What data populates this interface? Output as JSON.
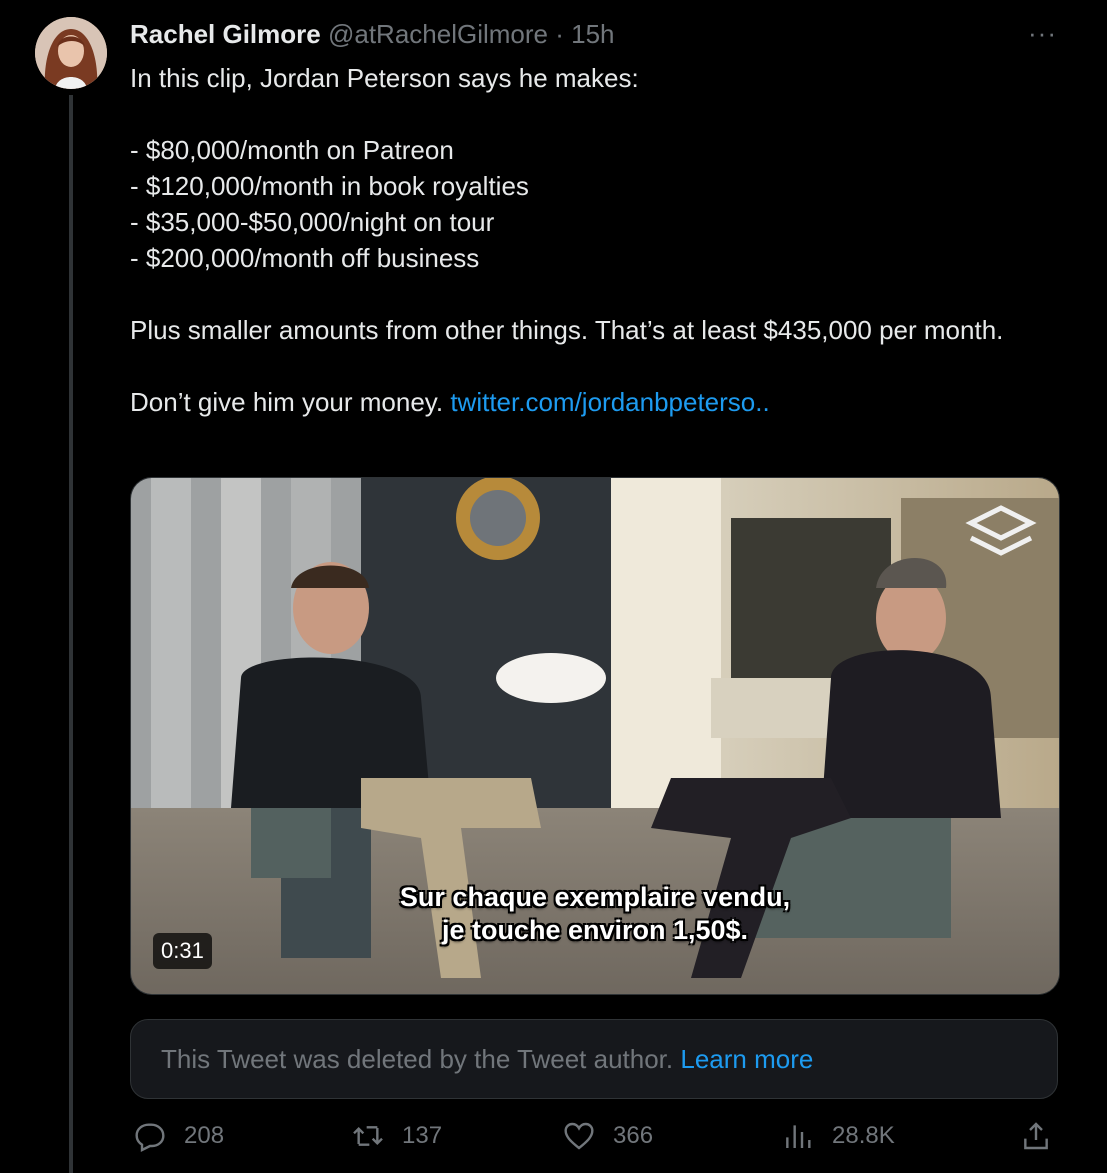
{
  "tweet": {
    "author_name": "Rachel Gilmore",
    "author_handle": "@atRachelGilmore",
    "separator": "·",
    "time": "15h",
    "more_label": "···",
    "lines": [
      "In this clip, Jordan Peterson says he makes:",
      "",
      "- $80,000/month on Patreon",
      "- $120,000/month in book royalties",
      "- $35,000-$50,000/night on tour",
      "- $200,000/month off business",
      "",
      "Plus smaller amounts from other things. That’s at least $435,000 per month.",
      ""
    ],
    "closing_text": "Don’t give him your money. ",
    "link_text": "twitter.com/jordanbpeterso.."
  },
  "video": {
    "duration": "0:31",
    "subtitle_line1": "Sur chaque exemplaire vendu,",
    "subtitle_line2": "je touche environ 1,50$."
  },
  "deleted_notice": {
    "text": "This Tweet was deleted by the Tweet author. ",
    "link": "Learn more"
  },
  "actions": {
    "replies": "208",
    "retweets": "137",
    "likes": "366",
    "views": "28.8K"
  },
  "colors": {
    "background": "#000000",
    "text": "#e7e9ea",
    "muted": "#71767b",
    "link": "#1d9bf0"
  }
}
